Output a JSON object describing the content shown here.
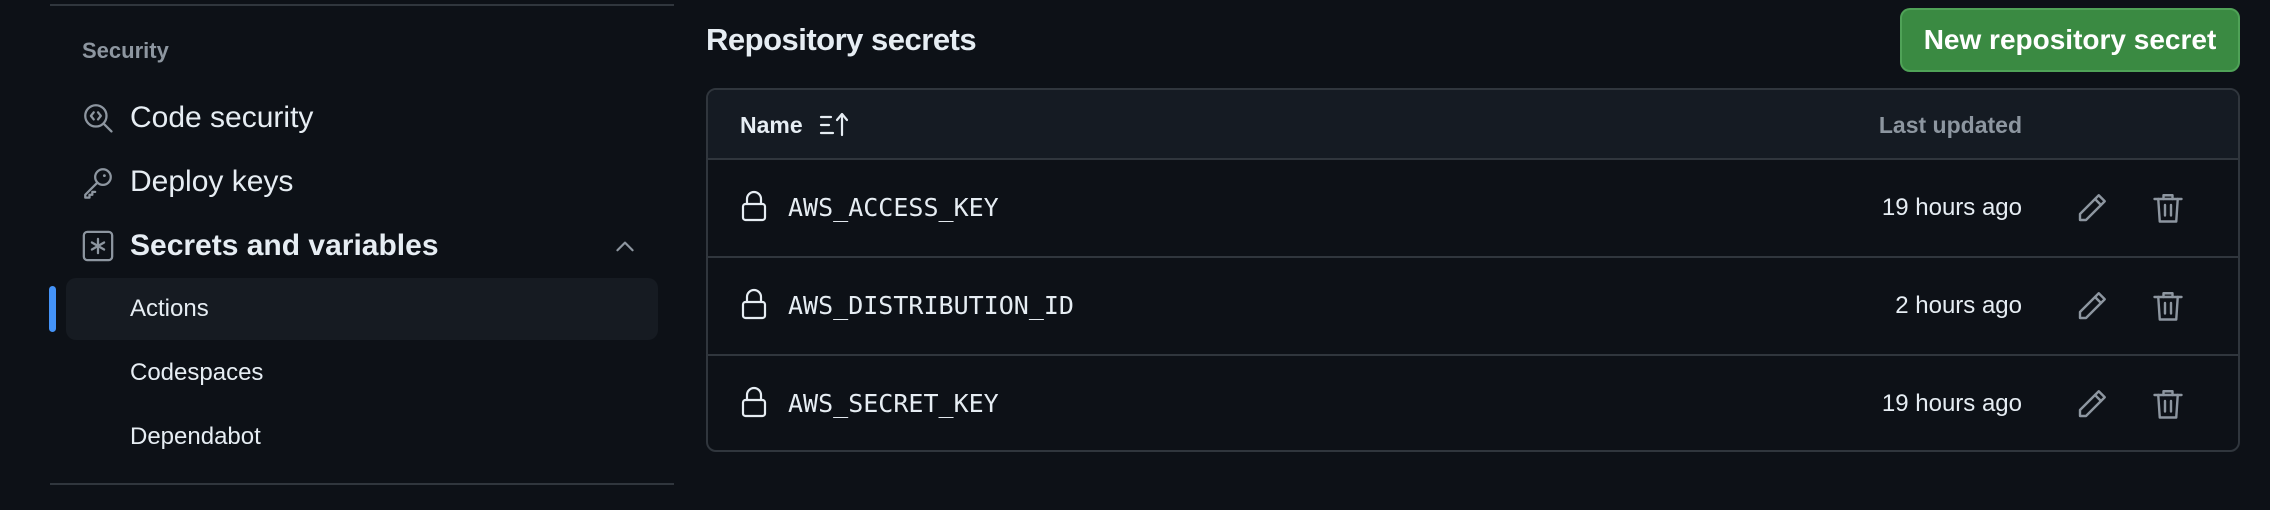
{
  "sidebar": {
    "heading": "Security",
    "items": [
      {
        "label": "Code security",
        "icon": "codescan-icon"
      },
      {
        "label": "Deploy keys",
        "icon": "key-icon"
      },
      {
        "label": "Secrets and variables",
        "icon": "asterisk-icon",
        "expanded": true
      }
    ],
    "sub_items": [
      {
        "label": "Actions",
        "active": true
      },
      {
        "label": "Codespaces",
        "active": false
      },
      {
        "label": "Dependabot",
        "active": false
      }
    ]
  },
  "main": {
    "title": "Repository secrets",
    "new_button_label": "New repository secret",
    "table": {
      "columns": {
        "name": "Name",
        "updated": "Last updated"
      },
      "rows": [
        {
          "name": "AWS_ACCESS_KEY",
          "updated": "19 hours ago"
        },
        {
          "name": "AWS_DISTRIBUTION_ID",
          "updated": "2 hours ago"
        },
        {
          "name": "AWS_SECRET_KEY",
          "updated": "19 hours ago"
        }
      ]
    }
  },
  "colors": {
    "background": "#0d1117",
    "accent": "#4493f8",
    "button": "#3a8a42",
    "border": "#30363d",
    "muted_text": "#8d96a0"
  }
}
